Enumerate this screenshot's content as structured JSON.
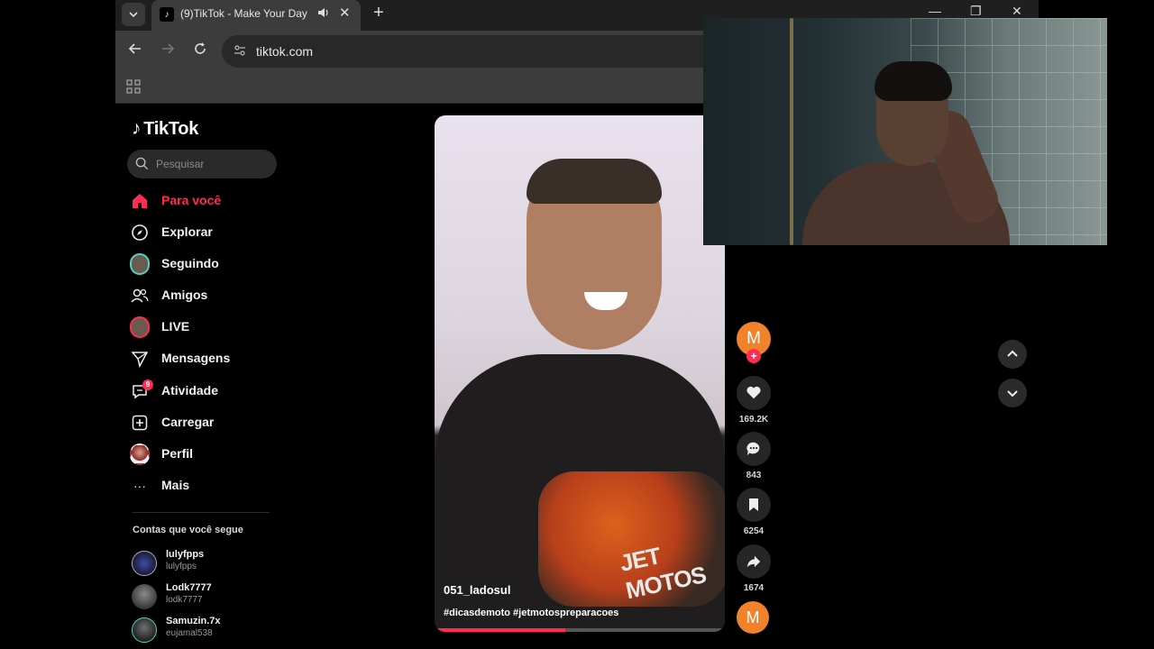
{
  "browser": {
    "tab_title": "(9)TikTok - Make Your Day",
    "favicon": "tiktok-icon",
    "new_tab_symbol": "+",
    "tab_close_symbol": "✕",
    "audio_symbol": "🔊",
    "url": "tiktok.com",
    "window": {
      "minimize": "—",
      "restore": "❐",
      "close": "✕"
    }
  },
  "sidebar": {
    "logo_text": "TikTok",
    "logo_note": "♪",
    "search_placeholder": "Pesquisar",
    "items": [
      {
        "label": "Para você",
        "icon": "home-icon",
        "active": true
      },
      {
        "label": "Explorar",
        "icon": "compass-icon"
      },
      {
        "label": "Seguindo",
        "icon": "following-avatar-icon"
      },
      {
        "label": "Amigos",
        "icon": "friends-icon"
      },
      {
        "label": "LIVE",
        "icon": "live-avatar-icon"
      },
      {
        "label": "Mensagens",
        "icon": "send-icon"
      },
      {
        "label": "Atividade",
        "icon": "activity-icon",
        "badge": "9"
      },
      {
        "label": "Carregar",
        "icon": "upload-icon"
      },
      {
        "label": "Perfil",
        "icon": "profile-avatar-icon"
      },
      {
        "label": "Mais",
        "icon": "more-icon"
      }
    ],
    "following_title": "Contas que você segue",
    "accounts": [
      {
        "name": "lulyfpps",
        "handle": "lulyfpps"
      },
      {
        "name": "Lodk7777",
        "handle": "lodk7777"
      },
      {
        "name": "Samuzin.7x",
        "handle": "eujamal538"
      }
    ]
  },
  "video": {
    "username": "051_ladosul",
    "hashtags": "#dicasdemoto #jetmotospreparacoes",
    "shirt_print": "JET MOTOS",
    "progress": 0.45
  },
  "actions": {
    "avatar_letter": "M",
    "follow_symbol": "+",
    "likes": "169.2K",
    "comments": "843",
    "saves": "6254",
    "shares": "1674",
    "sound_avatar_letter": "M"
  },
  "colors": {
    "accent": "#fe2c55",
    "avatar_orange": "#f2822a",
    "sidebar_bg": "#000000",
    "chrome_bg": "#3c3c3c"
  }
}
